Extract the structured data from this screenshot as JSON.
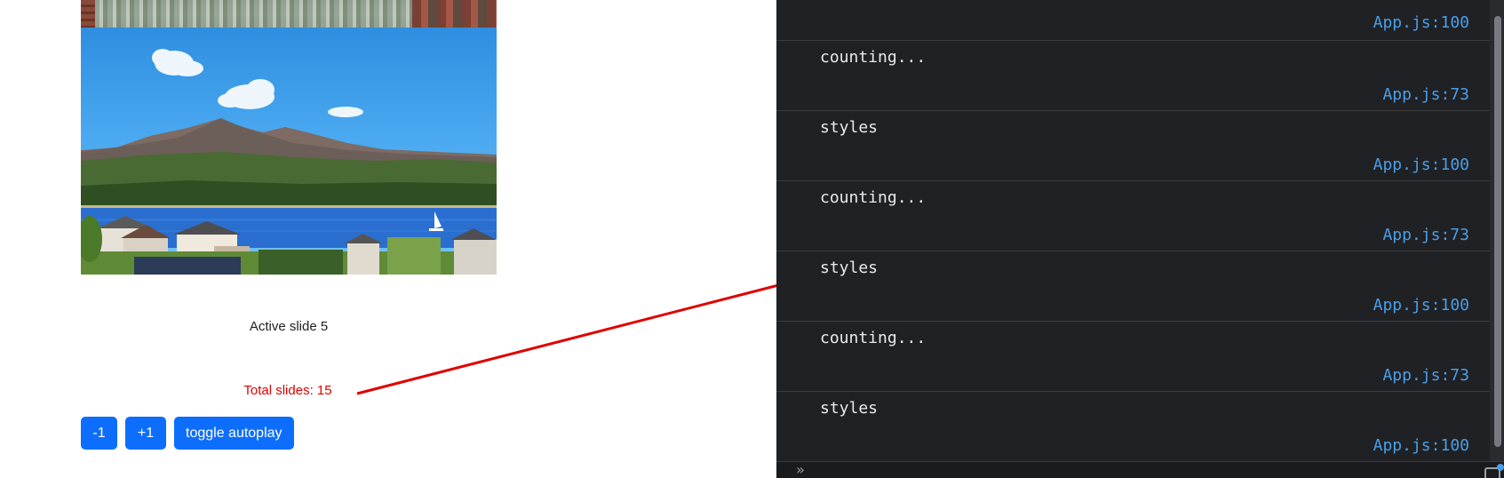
{
  "slider": {
    "active_text": "Active slide 5",
    "total_text": "Total slides: 15",
    "images": [
      "harbor-canal-photo",
      "mountain-lake-village-photo"
    ]
  },
  "controls": {
    "prev_label": "-1",
    "next_label": "+1",
    "toggle_label": "toggle autoplay"
  },
  "console": {
    "first_source": "App.js:100",
    "entries": [
      {
        "message": "counting...",
        "source": "App.js:73"
      },
      {
        "message": "styles",
        "source": "App.js:100"
      },
      {
        "message": "counting...",
        "source": "App.js:73"
      },
      {
        "message": "styles",
        "source": "App.js:100"
      },
      {
        "message": "counting...",
        "source": "App.js:73"
      },
      {
        "message": "styles",
        "source": "App.js:100"
      }
    ],
    "prompt_icon": "chevron-double-right-icon"
  },
  "colors": {
    "button_bg": "#0d6efd",
    "annotation_red": "#e00000",
    "console_bg": "#202124",
    "link_blue": "#4a9fe8"
  }
}
